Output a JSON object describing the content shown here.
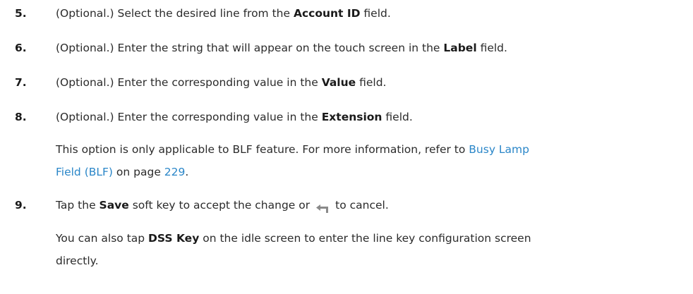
{
  "steps": [
    {
      "num": "5.",
      "pre": "(Optional.) Select the desired line from the ",
      "bold": "Account ID",
      "post": " field."
    },
    {
      "num": "6.",
      "pre": "(Optional.) Enter the string that will appear on the touch screen in the ",
      "bold": "Label",
      "post": " field."
    },
    {
      "num": "7.",
      "pre": "(Optional.) Enter the corresponding value in the ",
      "bold": "Value",
      "post": " field."
    },
    {
      "num": "8.",
      "pre": "(Optional.) Enter the corresponding value in the ",
      "bold": "Extension",
      "post": " field."
    },
    {
      "num": "9.",
      "pre": "Tap the ",
      "bold": "Save",
      "post": " soft key to accept the change or",
      "post2": "to cancel."
    }
  ],
  "note_blf": {
    "pre": "This option is only applicable to BLF feature. For more information, refer to ",
    "link_line1": "Busy Lamp",
    "link_line2": "Field (BLF)",
    "mid": " on page ",
    "page": "229",
    "end": "."
  },
  "note_dss": {
    "pre": "You can also tap ",
    "bold": "DSS Key",
    "line1_post": " on the idle screen to enter the line key configuration screen",
    "line2": "directly."
  },
  "colors": {
    "link": "#2a86c8",
    "icon": "#8a8a8a"
  },
  "icons": {
    "back": "back-arrow-icon"
  }
}
